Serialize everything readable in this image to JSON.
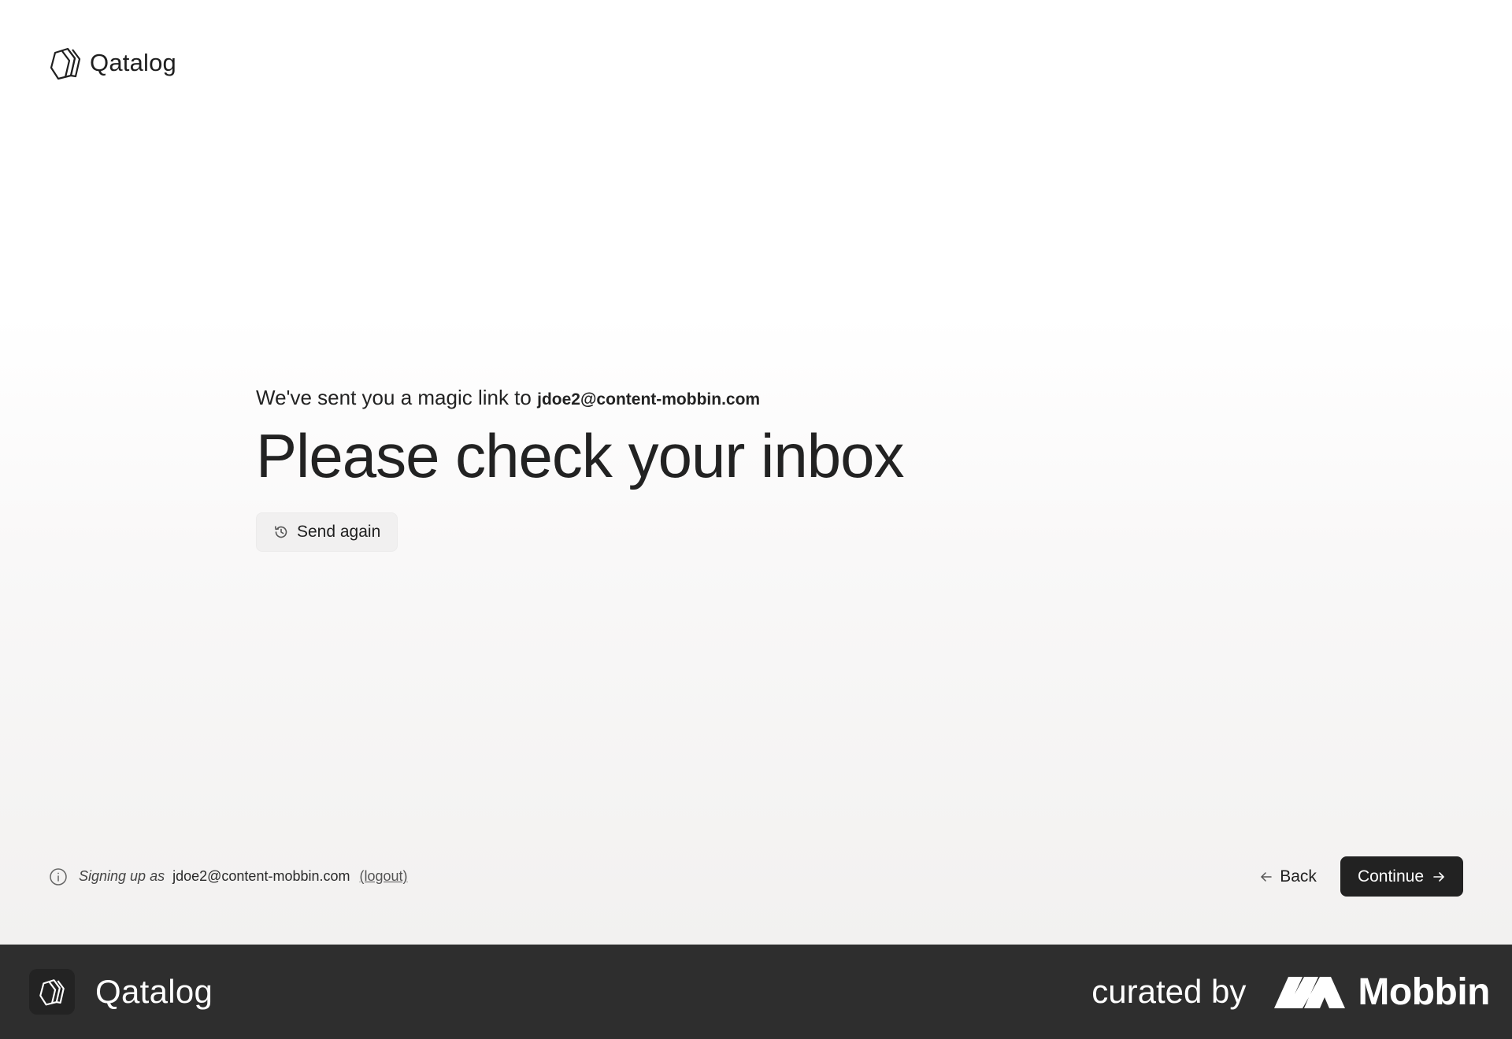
{
  "brand": {
    "name": "Qatalog"
  },
  "main": {
    "subtitle_prefix": "We've sent you a magic link to",
    "subtitle_email": "jdoe2@content-mobbin.com",
    "title": "Please check your inbox",
    "send_again_label": "Send again"
  },
  "footer": {
    "signup_label": "Signing up as",
    "signup_email": "jdoe2@content-mobbin.com",
    "logout_label": "(logout)",
    "back_label": "Back",
    "continue_label": "Continue"
  },
  "bottom_bar": {
    "app_name": "Qatalog",
    "curated_label": "curated by",
    "curator_name": "Mobbin"
  },
  "colors": {
    "primary_button": "#222222",
    "bottom_bar": "#2e2e2e",
    "secondary_button": "#f1f0f0"
  },
  "icons": {
    "brand": "qatalog-logo-icon",
    "send_again": "history-icon",
    "info": "info-icon",
    "back": "arrow-left-icon",
    "continue": "arrow-right-icon"
  }
}
